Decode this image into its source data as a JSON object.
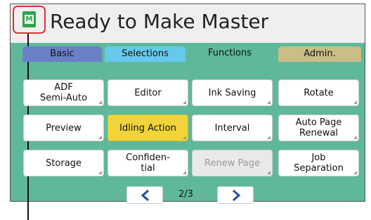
{
  "header": {
    "title": "Ready to Make Master",
    "master_icon_glyph": "M"
  },
  "tabs": [
    {
      "label": "Basic",
      "color": "#6b7fc6"
    },
    {
      "label": "Selections",
      "color": "#65c9ec"
    },
    {
      "label": "Functions",
      "color": "#5fb89a",
      "active": true
    },
    {
      "label": "Admin.",
      "color": "#c8be86"
    }
  ],
  "functions": [
    {
      "label": "ADF\nSemi-Auto"
    },
    {
      "label": "Editor"
    },
    {
      "label": "Ink Saving"
    },
    {
      "label": "Rotate"
    },
    {
      "label": "Preview"
    },
    {
      "label": "Idling Action",
      "state": "active"
    },
    {
      "label": "Interval"
    },
    {
      "label": "Auto Page\nRenewal"
    },
    {
      "label": "Storage"
    },
    {
      "label": "Confiden-\ntial"
    },
    {
      "label": "Renew Page",
      "state": "disabled"
    },
    {
      "label": "Job\nSeparation"
    }
  ],
  "pagination": {
    "indicator": "2/3"
  },
  "colors": {
    "panel": "#5fb89a",
    "highlight": "#f1d43a",
    "callout": "#e53030",
    "master_icon": "#2ea44a"
  }
}
